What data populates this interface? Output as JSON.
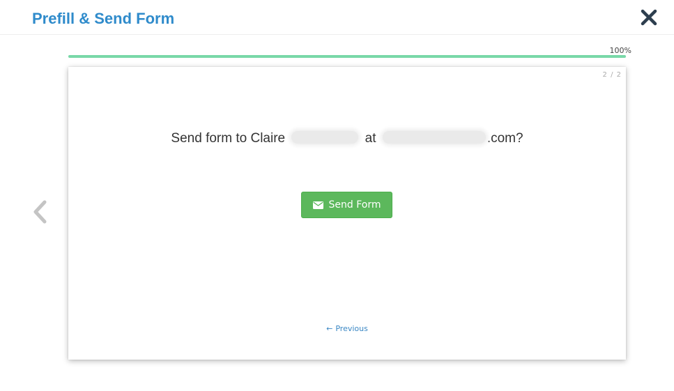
{
  "header": {
    "title": "Prefill & Send Form",
    "close_icon": "close-icon"
  },
  "progress": {
    "percent": 100,
    "label": "100%",
    "color": "#79d8a8"
  },
  "nav": {
    "previous_arrow_icon": "chevron-left-icon"
  },
  "card": {
    "page_indicator": "2 / 2",
    "question_prefix": "Send form to Claire",
    "question_middle": "at",
    "question_suffix": ".com?",
    "send_button_label": "Send Form",
    "send_button_icon": "envelope-icon",
    "send_button_color": "#5cb85c",
    "previous_link_label": "Previous",
    "previous_link_icon": "arrow-left-icon"
  },
  "colors": {
    "title": "#2f8bcb",
    "link": "#3a87c4"
  }
}
